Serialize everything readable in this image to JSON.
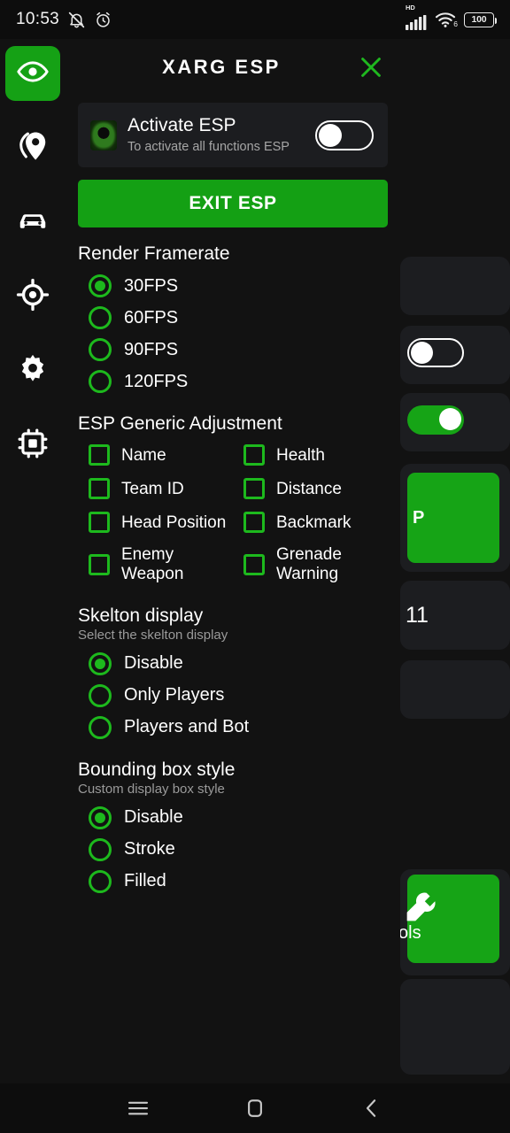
{
  "statusbar": {
    "time": "10:53",
    "mute_icon": "bell-muted-icon",
    "alarm_icon": "alarm-clock-icon",
    "network_label": "HD",
    "signal_icon": "cellular-signal-icon",
    "wifi_icon": "wifi-icon",
    "wifi_generation": "6",
    "battery_level": "100"
  },
  "rail": {
    "items": [
      {
        "icon": "eye-icon",
        "name": "rail-item-esp",
        "active": true
      },
      {
        "icon": "location-pin-icon",
        "name": "rail-item-location",
        "active": false
      },
      {
        "icon": "car-icon",
        "name": "rail-item-vehicle",
        "active": false
      },
      {
        "icon": "crosshair-icon",
        "name": "rail-item-aim",
        "active": false
      },
      {
        "icon": "gear-icon",
        "name": "rail-item-settings",
        "active": false
      },
      {
        "icon": "chip-icon",
        "name": "rail-item-memory",
        "active": false
      }
    ]
  },
  "panel": {
    "title": "XARG ESP",
    "close_icon": "close-icon",
    "activate_card": {
      "icon": "app-logo-icon",
      "title": "Activate ESP",
      "subtitle": "To activate all functions ESP",
      "toggle_state": "off"
    },
    "exit_button": "EXIT ESP",
    "sections": [
      {
        "id": "render-framerate",
        "title": "Render Framerate",
        "subtitle": "",
        "type": "radio",
        "options": [
          {
            "label": "30FPS",
            "selected": true
          },
          {
            "label": "60FPS",
            "selected": false
          },
          {
            "label": "90FPS",
            "selected": false
          },
          {
            "label": "120FPS",
            "selected": false
          }
        ]
      },
      {
        "id": "esp-generic-adjustment",
        "title": "ESP Generic Adjustment",
        "subtitle": "",
        "type": "checkbox-grid",
        "options": [
          {
            "label": "Name",
            "checked": false
          },
          {
            "label": "Health",
            "checked": false
          },
          {
            "label": "Team ID",
            "checked": false
          },
          {
            "label": "Distance",
            "checked": false
          },
          {
            "label": "Head Position",
            "checked": false
          },
          {
            "label": "Backmark",
            "checked": false
          },
          {
            "label": "Enemy Weapon",
            "checked": false
          },
          {
            "label": "Grenade Warning",
            "checked": false
          }
        ]
      },
      {
        "id": "skelton-display",
        "title": "Skelton display",
        "subtitle": "Select the skelton display",
        "type": "radio",
        "options": [
          {
            "label": "Disable",
            "selected": true
          },
          {
            "label": "Only Players",
            "selected": false
          },
          {
            "label": "Players and Bot",
            "selected": false
          }
        ]
      },
      {
        "id": "bounding-box-style",
        "title": "Bounding box style",
        "subtitle": "Custom display box style",
        "type": "radio",
        "options": [
          {
            "label": "Disable",
            "selected": true
          },
          {
            "label": "Stroke",
            "selected": false
          },
          {
            "label": "Filled",
            "selected": false
          }
        ]
      }
    ]
  },
  "background_app": {
    "partial_button_label": "P",
    "partial_text": "11",
    "partial_tools_label": "ols",
    "toggles": [
      {
        "state": "off"
      },
      {
        "state": "on"
      }
    ]
  },
  "navbar": {
    "recents_icon": "menu-icon",
    "home_icon": "home-square-icon",
    "back_icon": "chevron-left-icon"
  },
  "colors": {
    "accent_green": "#14a014",
    "bright_green": "#1db91d",
    "panel_bg": "#121212",
    "card_bg": "#1c1d20",
    "text_primary": "#ffffff",
    "text_secondary": "#9a9a9a"
  }
}
